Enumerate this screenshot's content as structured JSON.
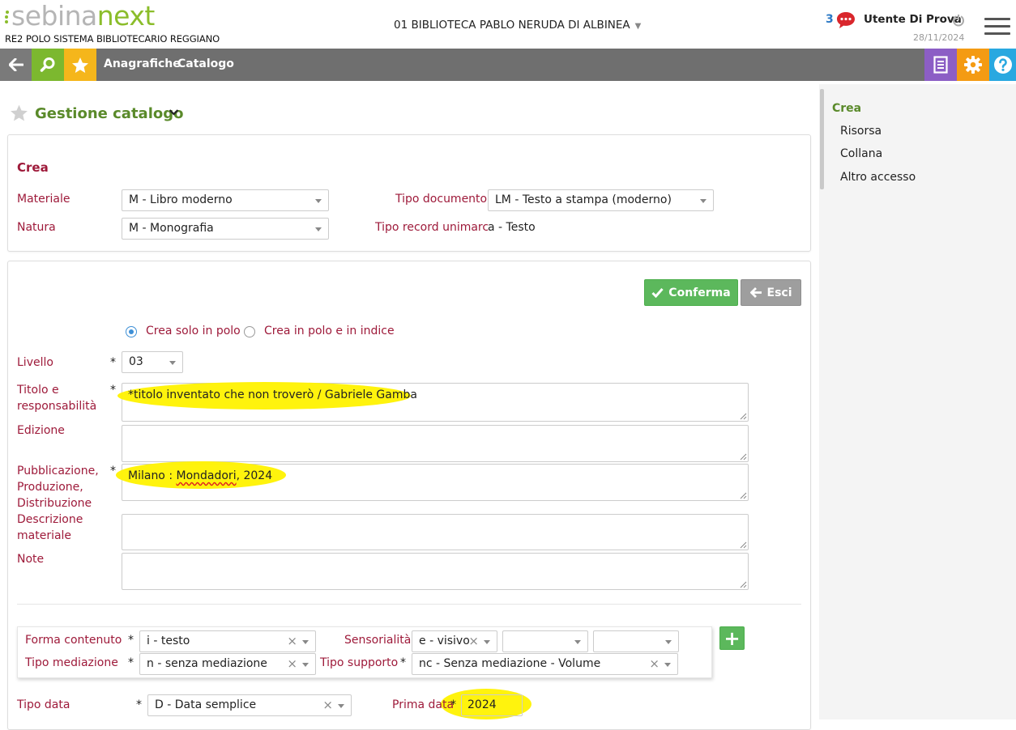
{
  "header": {
    "logo_part1": "sebina",
    "logo_part2": "next",
    "polo": "RE2 POLO SISTEMA BIBLIOTECARIO REGGIANO",
    "library": "01 BIBLIOTECA PABLO NERUDA DI ALBINEA",
    "notification_count": "3",
    "user_name": "Utente Di Prova",
    "date": "28/11/2024"
  },
  "nav": {
    "links": [
      "Anagrafiche",
      "Catalogo"
    ]
  },
  "page": {
    "title": "Gestione catalogo"
  },
  "crea_panel": {
    "heading": "Crea",
    "materiale_label": "Materiale",
    "materiale_value": "M - Libro moderno",
    "natura_label": "Natura",
    "natura_value": "M - Monografia",
    "tipo_documento_label": "Tipo documento",
    "tipo_documento_value": "LM - Testo a stampa (moderno)",
    "tipo_record_label": "Tipo record unimarc",
    "tipo_record_value": "a - Testo"
  },
  "form": {
    "confirm_label": "Conferma",
    "exit_label": "Esci",
    "radio_options": [
      "Crea solo in polo",
      "Crea in polo e in indice"
    ],
    "selected_radio": "Crea solo in polo",
    "required_mark": "*",
    "livello_label": "Livello",
    "livello_value": "03",
    "titolo_label": "Titolo e responsabilità",
    "titolo_value": "*titolo inventato che non troverò / Gabriele Gamba",
    "edizione_label": "Edizione",
    "edizione_value": "",
    "pubblicazione_label": "Pubblicazione, Produzione, Distribuzione",
    "pubblicazione_place": "Milano : ",
    "pubblicazione_publisher": "Mondadori",
    "pubblicazione_rest": ", 2024",
    "descrizione_label": "Descrizione materiale",
    "descrizione_value": "",
    "note_label": "Note",
    "note_value": "",
    "forma_contenuto_label": "Forma contenuto",
    "forma_contenuto_value": "i - testo",
    "sensorialita_label": "Sensorialità",
    "sensorialita_value": "e - visivo",
    "sensorialita_value2": "",
    "sensorialita_value3": "",
    "tipo_mediazione_label": "Tipo mediazione",
    "tipo_mediazione_value": "n - senza mediazione",
    "tipo_supporto_label": "Tipo supporto",
    "tipo_supporto_value": "nc - Senza mediazione - Volume",
    "add_label": "+",
    "tipo_data_label": "Tipo data",
    "tipo_data_value": "D - Data semplice",
    "prima_data_label": "Prima data",
    "prima_data_value": "2024",
    "clear_glyph": "×"
  },
  "sidebar": {
    "items": [
      "Crea",
      "Risorsa",
      "Collana",
      "Altro accesso"
    ],
    "active": "Crea"
  },
  "colors": {
    "label_red": "#9e1a3a",
    "title_green": "#5a8a2a",
    "nav_gray": "#6f6f6f",
    "search_green": "#7cb82f",
    "star_yellow": "#f5b61b",
    "doc_purple": "#8c5ec5",
    "gear_orange": "#f49b13",
    "help_blue": "#29a8e0",
    "confirm_green": "#5cb85c",
    "highlight_yellow": "#fff200"
  },
  "icons": [
    "chat-icon",
    "power-icon",
    "hamburger-menu-icon",
    "back-arrow-icon",
    "search-icon",
    "star-icon",
    "document-icon",
    "gear-icon",
    "help-icon",
    "chevron-down-icon",
    "check-icon",
    "arrow-left-icon",
    "plus-icon"
  ]
}
